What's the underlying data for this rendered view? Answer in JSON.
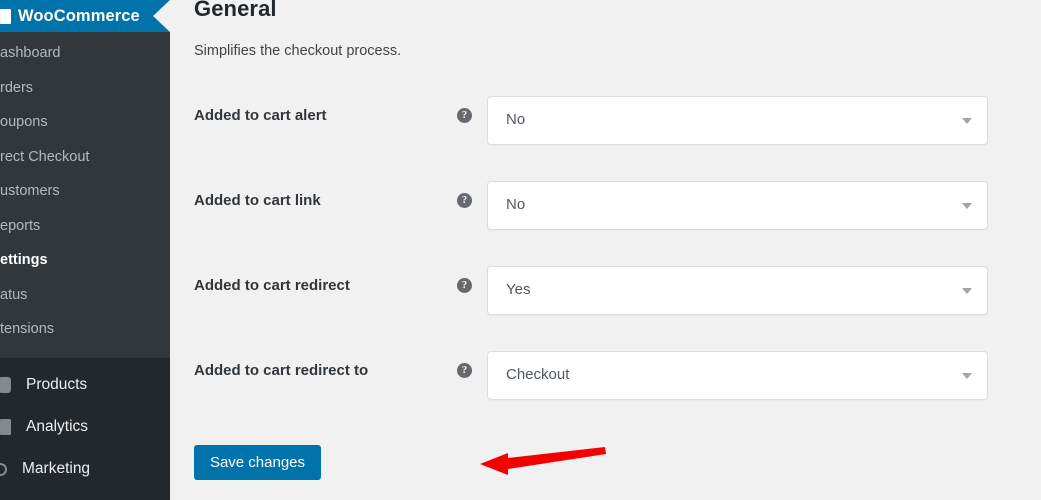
{
  "sidebar": {
    "brand": {
      "title": "WooCommerce",
      "logo_icon": "woocommerce-logo-icon"
    },
    "submenu_items": [
      {
        "label": "ashboard",
        "active": false
      },
      {
        "label": "rders",
        "active": false
      },
      {
        "label": "oupons",
        "active": false
      },
      {
        "label": "rect Checkout",
        "active": false
      },
      {
        "label": "ustomers",
        "active": false
      },
      {
        "label": "eports",
        "active": false
      },
      {
        "label": "ettings",
        "active": true
      },
      {
        "label": "atus",
        "active": false
      },
      {
        "label": "tensions",
        "active": false
      }
    ],
    "main_items": [
      {
        "label": "Products",
        "icon": "products-icon"
      },
      {
        "label": "Analytics",
        "icon": "analytics-icon"
      },
      {
        "label": "Marketing",
        "icon": "marketing-icon"
      }
    ]
  },
  "main": {
    "title": "General",
    "description": "Simplifies the checkout process.",
    "help_icon_glyph": "?",
    "fields": [
      {
        "label": "Added to cart alert",
        "value": "No",
        "help": "?"
      },
      {
        "label": "Added to cart link",
        "value": "No",
        "help": "?"
      },
      {
        "label": "Added to cart redirect",
        "value": "Yes",
        "help": "?"
      },
      {
        "label": "Added to cart redirect to",
        "value": "Checkout",
        "help": "?"
      }
    ],
    "save_label": "Save changes"
  },
  "annotation": {
    "arrow_color": "#f50000",
    "arrow_name": "red-pointer-arrow"
  },
  "colors": {
    "accent_blue": "#0073aa",
    "sidebar_dark": "#23282d",
    "sidebar_submenu": "#32373c",
    "page_bg": "#f1f1f1"
  }
}
